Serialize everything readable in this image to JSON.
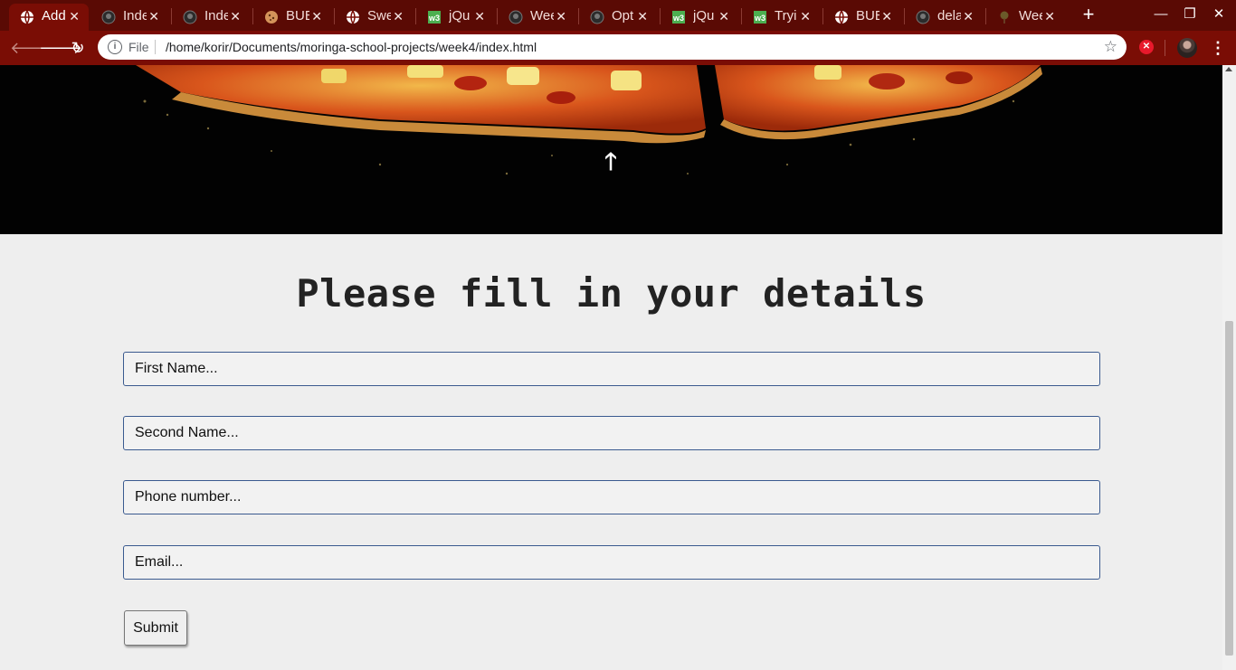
{
  "browser": {
    "tabs": [
      {
        "title": "Add",
        "icon": "globe-icon",
        "active": true
      },
      {
        "title": "Inde",
        "icon": "github-icon"
      },
      {
        "title": "Inde",
        "icon": "github-icon"
      },
      {
        "title": "BUE",
        "icon": "cookie-icon"
      },
      {
        "title": "Swe",
        "icon": "globe-icon"
      },
      {
        "title": "jQu",
        "icon": "w3schools-icon"
      },
      {
        "title": "Wee",
        "icon": "github-icon"
      },
      {
        "title": "Opt",
        "icon": "github-icon"
      },
      {
        "title": "jQu",
        "icon": "w3schools-icon"
      },
      {
        "title": "Tryi",
        "icon": "w3schools-icon"
      },
      {
        "title": "BUE",
        "icon": "globe-icon"
      },
      {
        "title": "dela",
        "icon": "github-icon"
      },
      {
        "title": "Wee",
        "icon": "tree-icon"
      }
    ],
    "close_glyph": "✕",
    "new_tab_glyph": "+",
    "address": {
      "scheme_label": "File",
      "url": "/home/korir/Documents/moringa-school-projects/week4/index.html"
    },
    "colors": {
      "tabstrip": "#5a0a04",
      "toolbar": "#7a0d05",
      "extension": "#e8192c"
    }
  },
  "page": {
    "form_title": "Please fill in your details",
    "fields": {
      "first_name": "First Name...",
      "second_name": "Second Name...",
      "phone": "Phone number...",
      "email": "Email..."
    },
    "submit_label": "Submit",
    "field_border_color": "#3a5a8f"
  }
}
